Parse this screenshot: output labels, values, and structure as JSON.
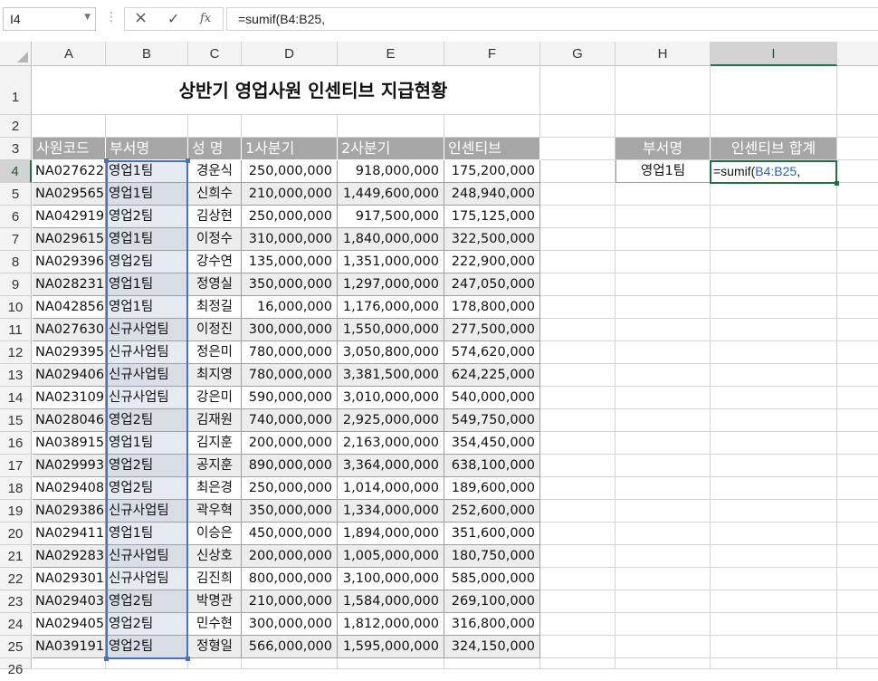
{
  "formula_bar": {
    "name_box": "I4",
    "formula": "=sumif(B4:B25,"
  },
  "columns": [
    "A",
    "B",
    "C",
    "D",
    "E",
    "F",
    "G",
    "H",
    "I"
  ],
  "rows": [
    "1",
    "2",
    "3",
    "4",
    "5",
    "6",
    "7",
    "8",
    "9",
    "10",
    "11",
    "12",
    "13",
    "14",
    "15",
    "16",
    "17",
    "18",
    "19",
    "20",
    "21",
    "22",
    "23",
    "24",
    "25",
    "26"
  ],
  "title": "상반기 영업사원 인센티브 지급현황",
  "table_headers": [
    "사원코드",
    "부서명",
    "성  명",
    "1사분기",
    "2사분기",
    "인센티브"
  ],
  "table_rows": [
    [
      "NA027622",
      "영업1팀",
      "경운식",
      "250,000,000",
      "918,000,000",
      "175,200,000"
    ],
    [
      "NA029565",
      "영업1팀",
      "신희수",
      "210,000,000",
      "1,449,600,000",
      "248,940,000"
    ],
    [
      "NA042919",
      "영업2팀",
      "김상현",
      "250,000,000",
      "917,500,000",
      "175,125,000"
    ],
    [
      "NA029615",
      "영업1팀",
      "이정수",
      "310,000,000",
      "1,840,000,000",
      "322,500,000"
    ],
    [
      "NA029396",
      "영업2팀",
      "강수연",
      "135,000,000",
      "1,351,000,000",
      "222,900,000"
    ],
    [
      "NA028231",
      "영업1팀",
      "정영실",
      "350,000,000",
      "1,297,000,000",
      "247,050,000"
    ],
    [
      "NA042856",
      "영업1팀",
      "최정길",
      "16,000,000",
      "1,176,000,000",
      "178,800,000"
    ],
    [
      "NA027630",
      "신규사업팀",
      "이정진",
      "300,000,000",
      "1,550,000,000",
      "277,500,000"
    ],
    [
      "NA029395",
      "신규사업팀",
      "정은미",
      "780,000,000",
      "3,050,800,000",
      "574,620,000"
    ],
    [
      "NA029406",
      "신규사업팀",
      "최지영",
      "780,000,000",
      "3,381,500,000",
      "624,225,000"
    ],
    [
      "NA023109",
      "신규사업팀",
      "강은미",
      "590,000,000",
      "3,010,000,000",
      "540,000,000"
    ],
    [
      "NA028046",
      "영업2팀",
      "김재원",
      "740,000,000",
      "2,925,000,000",
      "549,750,000"
    ],
    [
      "NA038915",
      "영업1팀",
      "김지훈",
      "200,000,000",
      "2,163,000,000",
      "354,450,000"
    ],
    [
      "NA029993",
      "영업2팀",
      "공지훈",
      "890,000,000",
      "3,364,000,000",
      "638,100,000"
    ],
    [
      "NA029408",
      "영업2팀",
      "최은경",
      "250,000,000",
      "1,014,000,000",
      "189,600,000"
    ],
    [
      "NA029386",
      "신규사업팀",
      "곽우혁",
      "350,000,000",
      "1,334,000,000",
      "252,600,000"
    ],
    [
      "NA029411",
      "영업1팀",
      "이승은",
      "450,000,000",
      "1,894,000,000",
      "351,600,000"
    ],
    [
      "NA029283",
      "신규사업팀",
      "신상호",
      "200,000,000",
      "1,005,000,000",
      "180,750,000"
    ],
    [
      "NA029301",
      "신규사업팀",
      "김진희",
      "800,000,000",
      "3,100,000,000",
      "585,000,000"
    ],
    [
      "NA029403",
      "영업2팀",
      "박명관",
      "210,000,000",
      "1,584,000,000",
      "269,100,000"
    ],
    [
      "NA029405",
      "영업2팀",
      "민수현",
      "300,000,000",
      "1,812,000,000",
      "316,800,000"
    ],
    [
      "NA039191",
      "영업2팀",
      "정형일",
      "566,000,000",
      "1,595,000,000",
      "324,150,000"
    ]
  ],
  "summary": {
    "headers": [
      "부서명",
      "인센티브 합계"
    ],
    "dept": "영업1팀",
    "editing_prefix": "=sumif(",
    "editing_ref": "B4:B25",
    "editing_suffix": ","
  },
  "colors": {
    "header_fill": "#a6a6a6",
    "band_fill": "#ededed",
    "selection_border": "#4472c4",
    "active_cell_border": "#217346"
  }
}
